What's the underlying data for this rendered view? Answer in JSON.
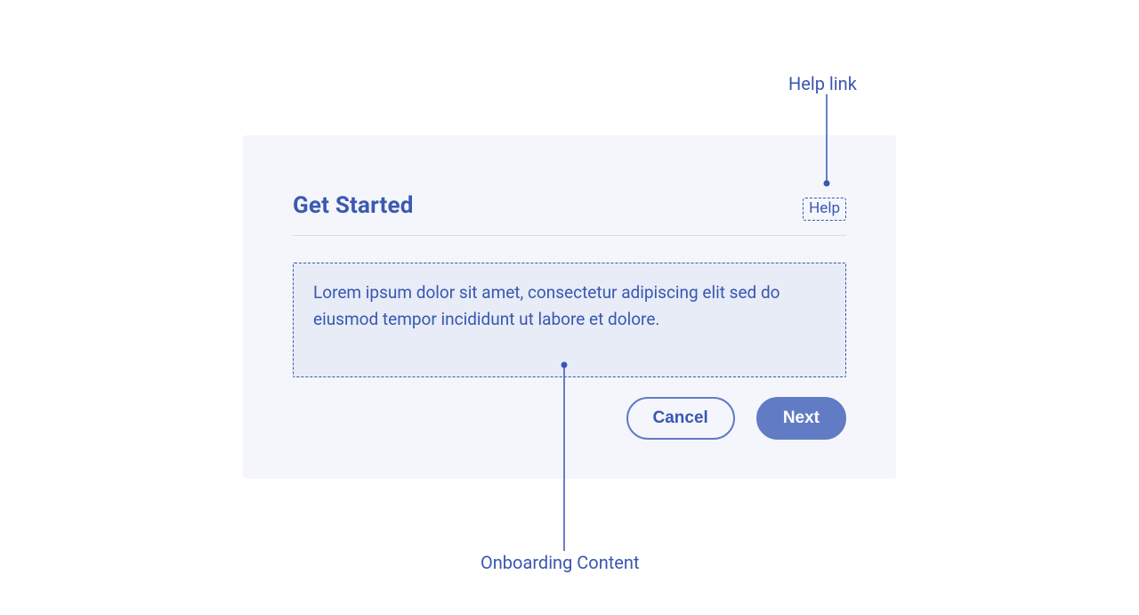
{
  "annotations": {
    "help_link": "Help link",
    "onboarding_content": "Onboarding Content"
  },
  "panel": {
    "title": "Get Started",
    "help_label": "Help",
    "body": "Lorem ipsum dolor sit amet, consectetur adipiscing elit sed do eiusmod tempor incididunt ut labore et dolore.",
    "cancel_label": "Cancel",
    "next_label": "Next"
  }
}
